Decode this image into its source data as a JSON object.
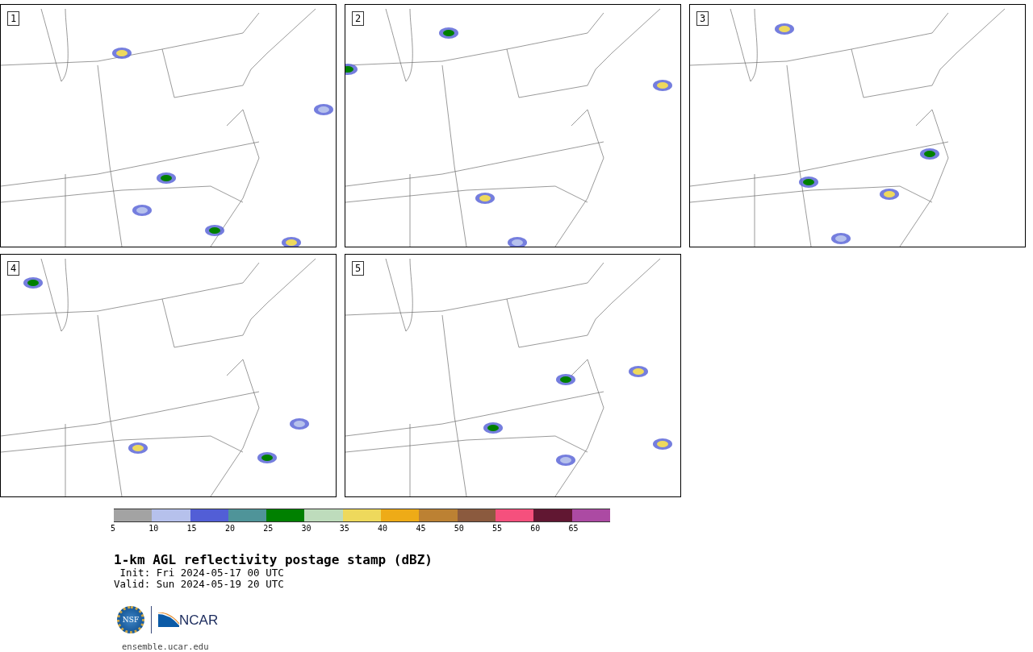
{
  "panels": [
    {
      "label": "1"
    },
    {
      "label": "2"
    },
    {
      "label": "3"
    },
    {
      "label": "4"
    },
    {
      "label": "5"
    }
  ],
  "colorbar": [
    {
      "label": "5",
      "color": "#a3a3a3"
    },
    {
      "label": "10",
      "color": "#b6c1ec"
    },
    {
      "label": "15",
      "color": "#525ed6"
    },
    {
      "label": "20",
      "color": "#4f9499"
    },
    {
      "label": "25",
      "color": "#008000"
    },
    {
      "label": "30",
      "color": "#bedcbc"
    },
    {
      "label": "35",
      "color": "#eed95c"
    },
    {
      "label": "40",
      "color": "#eeab17"
    },
    {
      "label": "45",
      "color": "#bc8133"
    },
    {
      "label": "50",
      "color": "#8b5a3e"
    },
    {
      "label": "55",
      "color": "#f5507d"
    },
    {
      "label": "60",
      "color": "#611732"
    },
    {
      "label": "65",
      "color": "#ac4aa3"
    }
  ],
  "title": "1-km AGL reflectivity postage stamp (dBZ)",
  "init": " Init: Fri 2024-05-17 00 UTC",
  "valid": "Valid: Sun 2024-05-19 20 UTC",
  "logo": {
    "nsf": "NSF",
    "ncar": "NCAR"
  },
  "url": "ensemble.ucar.edu"
}
